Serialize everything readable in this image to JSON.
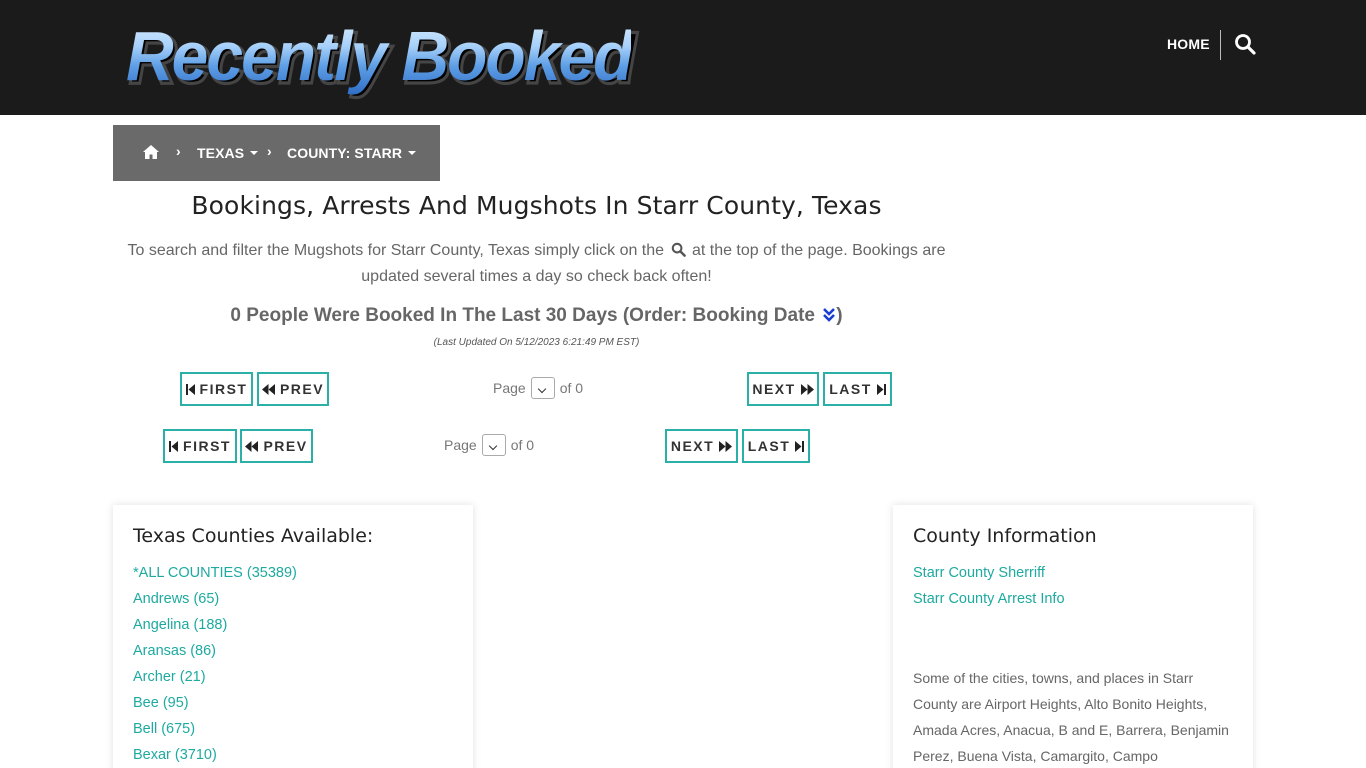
{
  "header": {
    "logo_text": "Recently Booked",
    "nav_home": "HOME"
  },
  "breadcrumb": {
    "state": "TEXAS",
    "county": "COUNTY: STARR"
  },
  "main": {
    "title": "Bookings, Arrests And Mugshots In Starr County, Texas",
    "intro_before": "To search and filter the Mugshots for Starr County, Texas simply click on the",
    "intro_after": "at the top of the page. Bookings are updated several times a day so check back often!",
    "booked_text": "0 People Were Booked In The Last 30 Days (Order: Booking Date",
    "booked_close": ")",
    "last_updated": "(Last Updated On 5/12/2023 6:21:49 PM EST)"
  },
  "pager": {
    "first": "FIRST",
    "prev": "PREV",
    "next": "NEXT",
    "last": "LAST",
    "page_label": "Page",
    "of_label": "of 0"
  },
  "counties_panel": {
    "title": "Texas Counties Available:",
    "items": [
      "*ALL COUNTIES (35389)",
      "Andrews (65)",
      "Angelina (188)",
      "Aransas (86)",
      "Archer (21)",
      "Bee (95)",
      "Bell (675)",
      "Bexar (3710)"
    ]
  },
  "county_info": {
    "title": "County Information",
    "links": [
      "Starr County Sherriff",
      "Starr County Arrest Info"
    ],
    "places_text": "Some of the cities, towns, and places in Starr County are Airport Heights, Alto Bonito Heights, Amada Acres, Anacua, B and E, Barrera, Benjamin Perez, Buena Vista, Camargito, Campo"
  },
  "colors": {
    "header_bg": "#1b1b1b",
    "breadcrumb_bg": "#6a6a6a",
    "accent_teal": "#2ab0a6",
    "link_teal": "#1eaaa0",
    "sort_icon_blue": "#1a3fcf"
  }
}
